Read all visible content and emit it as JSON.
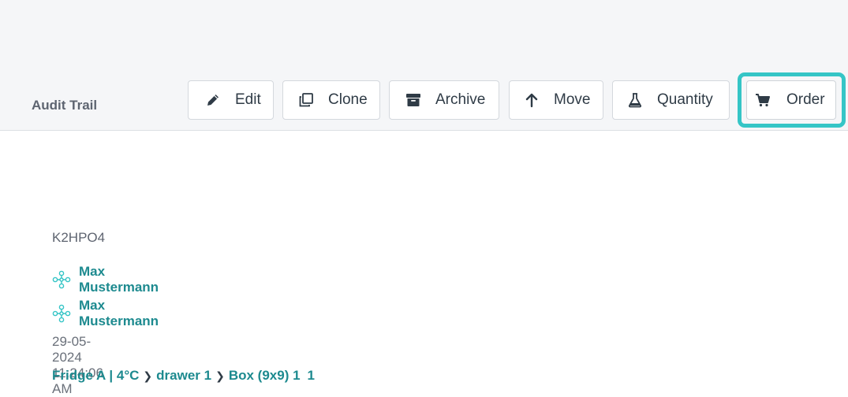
{
  "header": {
    "audit_trail_label": "Audit Trail"
  },
  "toolbar": {
    "edit_label": "Edit",
    "clone_label": "Clone",
    "archive_label": "Archive",
    "move_label": "Move",
    "quantity_label": "Quantity",
    "order_label": "Order",
    "highlight_color": "#35c5c6"
  },
  "details": {
    "item_name": "K2HPO4",
    "created_by": "Max Mustermann",
    "owner": "Max Mustermann",
    "timestamp": "29-05-2024 11:24:06 AM",
    "location": {
      "fridge": "Fridge A | 4°C",
      "drawer": "drawer 1",
      "box": "Box (9x9) 1",
      "position": "1"
    }
  },
  "colors": {
    "link": "#1d8a8f",
    "text": "#2f3b46",
    "muted": "#6a707a"
  }
}
